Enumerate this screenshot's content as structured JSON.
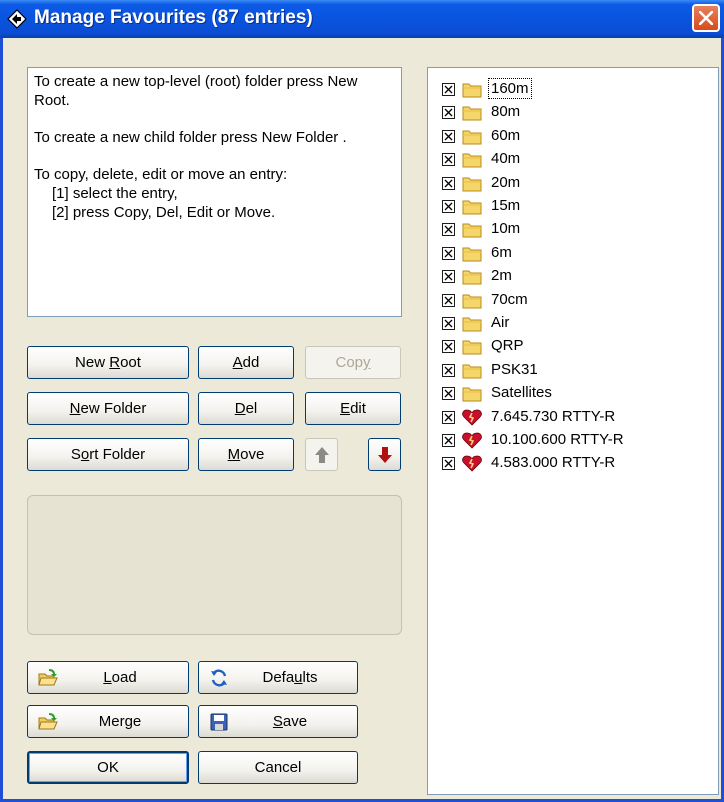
{
  "window": {
    "title": "Manage Favourites (87 entries)"
  },
  "instructions": {
    "line1": "To create a new top-level (root) folder press New Root.",
    "line2": "To create a new child folder press New Folder .",
    "line3": "To copy, delete, edit or move an entry:",
    "step1": "[1] select the entry,",
    "step2": "[2] press Copy, Del, Edit or Move."
  },
  "buttons": {
    "new_root": {
      "pre": "New ",
      "key": "R",
      "post": "oot"
    },
    "add": {
      "pre": "",
      "key": "A",
      "post": "dd"
    },
    "copy": {
      "pre": "Cop",
      "key": "y",
      "post": ""
    },
    "new_folder": {
      "pre": "",
      "key": "N",
      "post": "ew Folder"
    },
    "del": {
      "pre": "",
      "key": "D",
      "post": "el"
    },
    "edit": {
      "pre": "",
      "key": "E",
      "post": "dit"
    },
    "sort_folder": {
      "pre": "S",
      "key": "o",
      "post": "rt Folder"
    },
    "move": {
      "pre": "",
      "key": "M",
      "post": "ove"
    },
    "load": {
      "pre": "",
      "key": "L",
      "post": "oad"
    },
    "defaults": {
      "pre": "Defa",
      "key": "u",
      "post": "lts"
    },
    "merge": {
      "pre": "Merge",
      "key": "",
      "post": ""
    },
    "save": {
      "pre": "",
      "key": "S",
      "post": "ave"
    },
    "ok": "OK",
    "cancel": "Cancel"
  },
  "tree": {
    "items": [
      {
        "label": "160m",
        "icon": "folder-icon",
        "checked": true,
        "selected": true
      },
      {
        "label": "80m",
        "icon": "folder-icon",
        "checked": true
      },
      {
        "label": "60m",
        "icon": "folder-icon",
        "checked": true
      },
      {
        "label": "40m",
        "icon": "folder-icon",
        "checked": true
      },
      {
        "label": "20m",
        "icon": "folder-icon",
        "checked": true
      },
      {
        "label": "15m",
        "icon": "folder-icon",
        "checked": true
      },
      {
        "label": "10m",
        "icon": "folder-icon",
        "checked": true
      },
      {
        "label": "6m",
        "icon": "folder-icon",
        "checked": true
      },
      {
        "label": "2m",
        "icon": "folder-icon",
        "checked": true
      },
      {
        "label": "70cm",
        "icon": "folder-icon",
        "checked": true
      },
      {
        "label": "Air",
        "icon": "folder-icon",
        "checked": true
      },
      {
        "label": "QRP",
        "icon": "folder-icon",
        "checked": true
      },
      {
        "label": "PSK31",
        "icon": "folder-icon",
        "checked": true
      },
      {
        "label": "Satellites",
        "icon": "folder-icon",
        "checked": true
      },
      {
        "label": "7.645.730 RTTY-R",
        "icon": "broken-heart-icon",
        "checked": true
      },
      {
        "label": "10.100.600 RTTY-R",
        "icon": "broken-heart-icon",
        "checked": true
      },
      {
        "label": "4.583.000 RTTY-R",
        "icon": "broken-heart-icon",
        "checked": true
      }
    ]
  },
  "colors": {
    "titlebar": "#0a54df",
    "close_button": "#d84a1c",
    "dialog_bg": "#ece9d8",
    "folder": "#f5d66b",
    "heart": "#c8102e"
  }
}
